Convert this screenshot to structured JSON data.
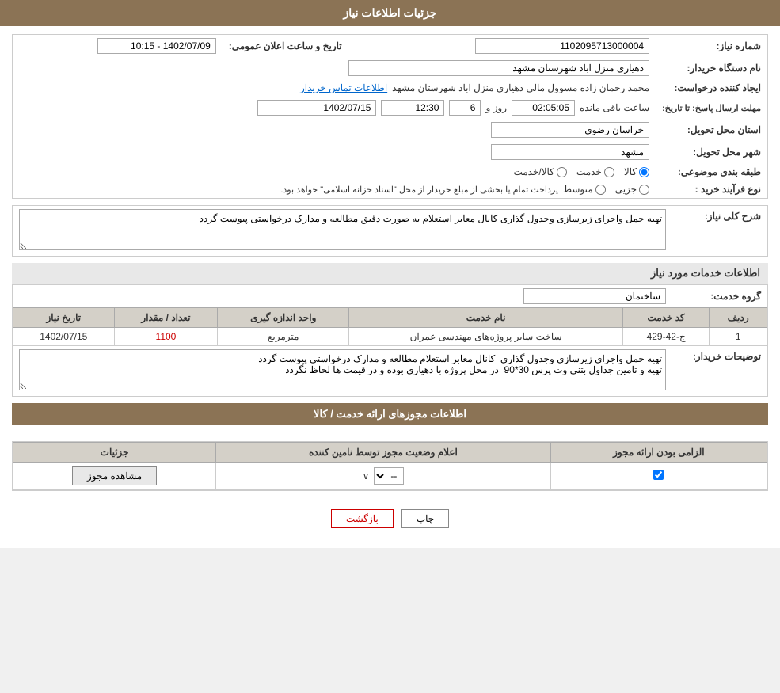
{
  "page": {
    "title": "جزئیات اطلاعات نیاز"
  },
  "fields": {
    "need_number_label": "شماره نیاز:",
    "need_number_value": "1102095713000004",
    "buyer_dept_label": "نام دستگاه خریدار:",
    "buyer_dept_value": "دهیاری منزل اباد شهرستان مشهد",
    "announce_date_label": "تاریخ و ساعت اعلان عمومی:",
    "announce_date_value": "1402/07/09 - 10:15",
    "creator_label": "ایجاد کننده درخواست:",
    "creator_value": "محمد رحمان زاده مسوول مالی  دهیاری منزل اباد شهرستان مشهد",
    "contact_link": "اطلاعات تماس خریدار",
    "response_deadline_label": "مهلت ارسال پاسخ: تا تاریخ:",
    "response_date": "1402/07/15",
    "response_time": "12:30",
    "response_days": "6",
    "response_remaining": "02:05:05",
    "response_day_label": "روز و",
    "response_hour_label": "ساعت باقی مانده",
    "province_label": "استان محل تحویل:",
    "province_value": "خراسان رضوی",
    "city_label": "شهر محل تحویل:",
    "city_value": "مشهد",
    "category_label": "طبقه بندی موضوعی:",
    "category_options": [
      "کالا",
      "خدمت",
      "کالا/خدمت"
    ],
    "category_selected": "کالا",
    "process_label": "نوع فرآیند خرید :",
    "process_options": [
      "جزیی",
      "متوسط"
    ],
    "process_note": "پرداخت تمام یا بخشی از مبلغ خریدار از محل \"اسناد خزانه اسلامی\" خواهد بود.",
    "description_label": "شرح کلی نیاز:",
    "description_value": "تهیه حمل واجرای زیرسازی وجدول گذاری کانال معابر استعلام به صورت دقیق مطالعه و مدارک درخواستی پیوست گردد"
  },
  "services_section": {
    "title": "اطلاعات خدمات مورد نیاز",
    "service_group_label": "گروه خدمت:",
    "service_group_value": "ساختمان",
    "table": {
      "columns": [
        "ردیف",
        "کد خدمت",
        "نام خدمت",
        "واحد اندازه گیری",
        "تعداد / مقدار",
        "تاریخ نیاز"
      ],
      "rows": [
        {
          "row_num": "1",
          "service_code": "ج-42-429",
          "service_name": "ساخت سایر پروژه‌های مهندسی عمران",
          "unit": "مترمربع",
          "quantity": "1100",
          "date": "1402/07/15"
        }
      ]
    },
    "buyer_notes_label": "توضیحات خریدار:",
    "buyer_notes_value": "تهیه حمل واجرای زیرسازی وجدول گذاری  کانال معابر استعلام مطالعه و مدارک درخواستی پیوست گردد\nتهیه و تامین جداول بتنی وت پرس 30*90  در محل پروژه با دهیاری بوده و در قیمت ها لحاظ نگردد"
  },
  "permissions_section": {
    "title": "اطلاعات مجوزهای ارائه خدمت / کالا",
    "table": {
      "columns": [
        "الزامی بودن ارائه مجوز",
        "اعلام وضعیت مجوز توسط نامین کننده",
        "جزئیات"
      ],
      "rows": [
        {
          "required": true,
          "status": "--",
          "detail_btn": "مشاهده مجوز"
        }
      ]
    }
  },
  "buttons": {
    "print": "چاپ",
    "back": "بازگشت"
  }
}
